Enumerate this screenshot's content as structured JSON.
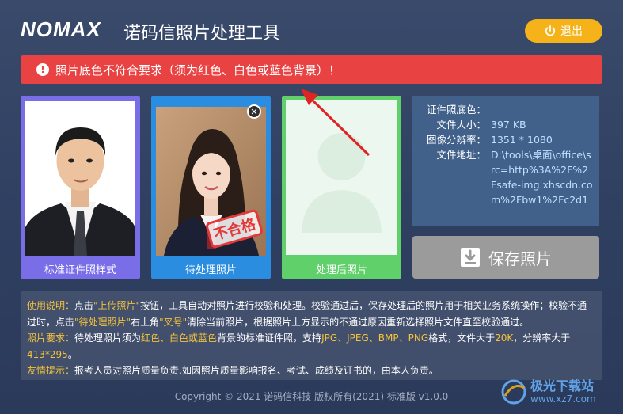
{
  "header": {
    "logo": "NOMAX",
    "title": "诺码信照片处理工具",
    "exit_label": "退出"
  },
  "alert": {
    "message": "照片底色不符合要求（须为红色、白色或蓝色背景）！"
  },
  "cards": {
    "standard_caption": "标准证件照样式",
    "pending_caption": "待处理照片",
    "processed_caption": "处理后照片",
    "stamp": "不合格"
  },
  "info": {
    "bg_color_label": "证件照底色：",
    "bg_color_value": "",
    "size_label": "文件大小：",
    "size_value": "397 KB",
    "resolution_label": "图像分辨率：",
    "resolution_value": "1351 * 1080",
    "path_label": "文件地址：",
    "path_value": "D:\\tools\\桌面\\office\\src=http%3A%2F%2Fsafe-img.xhscdn.com%2Fbw1%2Fc2d1e633..."
  },
  "save_label": "保存照片",
  "instructions": {
    "usage_label": "使用说明：",
    "usage_1": "点击",
    "usage_upload": "\"上传照片\"",
    "usage_2": "按钮，工具自动对照片进行校验和处理。校验通过后，保存处理后的照片用于相关业务系统操作；校验不通过时，点击",
    "usage_pending": "\"待处理照片\"",
    "usage_3": "右上角",
    "usage_x": "\"叉号\"",
    "usage_4": "清除当前照片，根据照片上方显示的不通过原因重新选择照片文件直至校验通过。",
    "req_label": "照片要求：",
    "req_1": "待处理照片须为",
    "req_colors": "红色、白色或蓝色",
    "req_2": "背景的标准证件照，支持",
    "req_formats": "JPG、JPEG、BMP、PNG",
    "req_3": "格式，文件大于",
    "req_size": "20K",
    "req_4": "，分辨率大于",
    "req_res": "413*295",
    "req_5": "。",
    "tip_label": "友情提示：",
    "tip_text": "报考人员对照片质量负责,如因照片质量影响报名、考试、成绩及证书的，由本人负责。"
  },
  "footer": "Copyright © 2021 诺码信科技 版权所有(2021) 标准版 v1.0.0",
  "watermark": {
    "text": "极光下载站",
    "sub": "www.xz7.com"
  },
  "colors": {
    "background": "#34456a",
    "alert": "#e94242",
    "exit_button": "#f5b319",
    "standard_border": "#7a6ee8",
    "pending_border": "#2b8de0",
    "processed_border": "#5fd06a",
    "highlight_text": "#f5c33b",
    "info_value": "#bfe0ff",
    "save_button": "#9b9b9b"
  },
  "icons": [
    "power-icon",
    "alert-circle-icon",
    "close-icon",
    "save-icon",
    "avatar-placeholder-icon",
    "arrow-annotation-icon"
  ]
}
